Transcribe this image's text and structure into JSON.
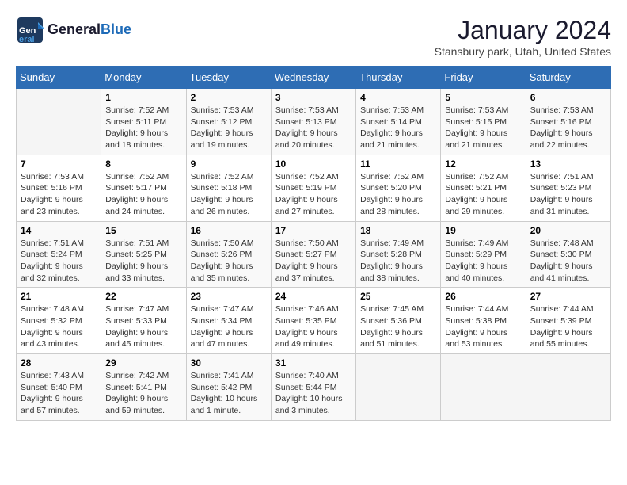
{
  "header": {
    "logo_general": "General",
    "logo_blue": "Blue",
    "title": "January 2024",
    "subtitle": "Stansbury park, Utah, United States"
  },
  "weekdays": [
    "Sunday",
    "Monday",
    "Tuesday",
    "Wednesday",
    "Thursday",
    "Friday",
    "Saturday"
  ],
  "weeks": [
    [
      {
        "day": "",
        "info": ""
      },
      {
        "day": "1",
        "info": "Sunrise: 7:52 AM\nSunset: 5:11 PM\nDaylight: 9 hours\nand 18 minutes."
      },
      {
        "day": "2",
        "info": "Sunrise: 7:53 AM\nSunset: 5:12 PM\nDaylight: 9 hours\nand 19 minutes."
      },
      {
        "day": "3",
        "info": "Sunrise: 7:53 AM\nSunset: 5:13 PM\nDaylight: 9 hours\nand 20 minutes."
      },
      {
        "day": "4",
        "info": "Sunrise: 7:53 AM\nSunset: 5:14 PM\nDaylight: 9 hours\nand 21 minutes."
      },
      {
        "day": "5",
        "info": "Sunrise: 7:53 AM\nSunset: 5:15 PM\nDaylight: 9 hours\nand 21 minutes."
      },
      {
        "day": "6",
        "info": "Sunrise: 7:53 AM\nSunset: 5:16 PM\nDaylight: 9 hours\nand 22 minutes."
      }
    ],
    [
      {
        "day": "7",
        "info": "Sunrise: 7:53 AM\nSunset: 5:16 PM\nDaylight: 9 hours\nand 23 minutes."
      },
      {
        "day": "8",
        "info": "Sunrise: 7:52 AM\nSunset: 5:17 PM\nDaylight: 9 hours\nand 24 minutes."
      },
      {
        "day": "9",
        "info": "Sunrise: 7:52 AM\nSunset: 5:18 PM\nDaylight: 9 hours\nand 26 minutes."
      },
      {
        "day": "10",
        "info": "Sunrise: 7:52 AM\nSunset: 5:19 PM\nDaylight: 9 hours\nand 27 minutes."
      },
      {
        "day": "11",
        "info": "Sunrise: 7:52 AM\nSunset: 5:20 PM\nDaylight: 9 hours\nand 28 minutes."
      },
      {
        "day": "12",
        "info": "Sunrise: 7:52 AM\nSunset: 5:21 PM\nDaylight: 9 hours\nand 29 minutes."
      },
      {
        "day": "13",
        "info": "Sunrise: 7:51 AM\nSunset: 5:23 PM\nDaylight: 9 hours\nand 31 minutes."
      }
    ],
    [
      {
        "day": "14",
        "info": "Sunrise: 7:51 AM\nSunset: 5:24 PM\nDaylight: 9 hours\nand 32 minutes."
      },
      {
        "day": "15",
        "info": "Sunrise: 7:51 AM\nSunset: 5:25 PM\nDaylight: 9 hours\nand 33 minutes."
      },
      {
        "day": "16",
        "info": "Sunrise: 7:50 AM\nSunset: 5:26 PM\nDaylight: 9 hours\nand 35 minutes."
      },
      {
        "day": "17",
        "info": "Sunrise: 7:50 AM\nSunset: 5:27 PM\nDaylight: 9 hours\nand 37 minutes."
      },
      {
        "day": "18",
        "info": "Sunrise: 7:49 AM\nSunset: 5:28 PM\nDaylight: 9 hours\nand 38 minutes."
      },
      {
        "day": "19",
        "info": "Sunrise: 7:49 AM\nSunset: 5:29 PM\nDaylight: 9 hours\nand 40 minutes."
      },
      {
        "day": "20",
        "info": "Sunrise: 7:48 AM\nSunset: 5:30 PM\nDaylight: 9 hours\nand 41 minutes."
      }
    ],
    [
      {
        "day": "21",
        "info": "Sunrise: 7:48 AM\nSunset: 5:32 PM\nDaylight: 9 hours\nand 43 minutes."
      },
      {
        "day": "22",
        "info": "Sunrise: 7:47 AM\nSunset: 5:33 PM\nDaylight: 9 hours\nand 45 minutes."
      },
      {
        "day": "23",
        "info": "Sunrise: 7:47 AM\nSunset: 5:34 PM\nDaylight: 9 hours\nand 47 minutes."
      },
      {
        "day": "24",
        "info": "Sunrise: 7:46 AM\nSunset: 5:35 PM\nDaylight: 9 hours\nand 49 minutes."
      },
      {
        "day": "25",
        "info": "Sunrise: 7:45 AM\nSunset: 5:36 PM\nDaylight: 9 hours\nand 51 minutes."
      },
      {
        "day": "26",
        "info": "Sunrise: 7:44 AM\nSunset: 5:38 PM\nDaylight: 9 hours\nand 53 minutes."
      },
      {
        "day": "27",
        "info": "Sunrise: 7:44 AM\nSunset: 5:39 PM\nDaylight: 9 hours\nand 55 minutes."
      }
    ],
    [
      {
        "day": "28",
        "info": "Sunrise: 7:43 AM\nSunset: 5:40 PM\nDaylight: 9 hours\nand 57 minutes."
      },
      {
        "day": "29",
        "info": "Sunrise: 7:42 AM\nSunset: 5:41 PM\nDaylight: 9 hours\nand 59 minutes."
      },
      {
        "day": "30",
        "info": "Sunrise: 7:41 AM\nSunset: 5:42 PM\nDaylight: 10 hours\nand 1 minute."
      },
      {
        "day": "31",
        "info": "Sunrise: 7:40 AM\nSunset: 5:44 PM\nDaylight: 10 hours\nand 3 minutes."
      },
      {
        "day": "",
        "info": ""
      },
      {
        "day": "",
        "info": ""
      },
      {
        "day": "",
        "info": ""
      }
    ]
  ]
}
